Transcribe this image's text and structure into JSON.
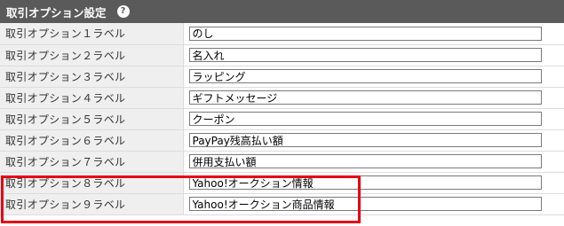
{
  "section": {
    "title": "取引オプション設定",
    "help_icon": "?"
  },
  "rows": [
    {
      "label": "取引オプション１ラベル",
      "value": "のし"
    },
    {
      "label": "取引オプション２ラベル",
      "value": "名入れ"
    },
    {
      "label": "取引オプション３ラベル",
      "value": "ラッピング"
    },
    {
      "label": "取引オプション４ラベル",
      "value": "ギフトメッセージ"
    },
    {
      "label": "取引オプション５ラベル",
      "value": "クーポン"
    },
    {
      "label": "取引オプション６ラベル",
      "value": "PayPay残高払い額"
    },
    {
      "label": "取引オプション７ラベル",
      "value": "併用支払い額"
    },
    {
      "label": "取引オプション８ラベル",
      "value": "Yahoo!オークション情報"
    },
    {
      "label": "取引オプション９ラベル",
      "value": "Yahoo!オークション商品情報"
    }
  ],
  "colors": {
    "header_bg": "#5a5a5a",
    "label_bg": "#efefef",
    "highlight": "#e60012"
  }
}
